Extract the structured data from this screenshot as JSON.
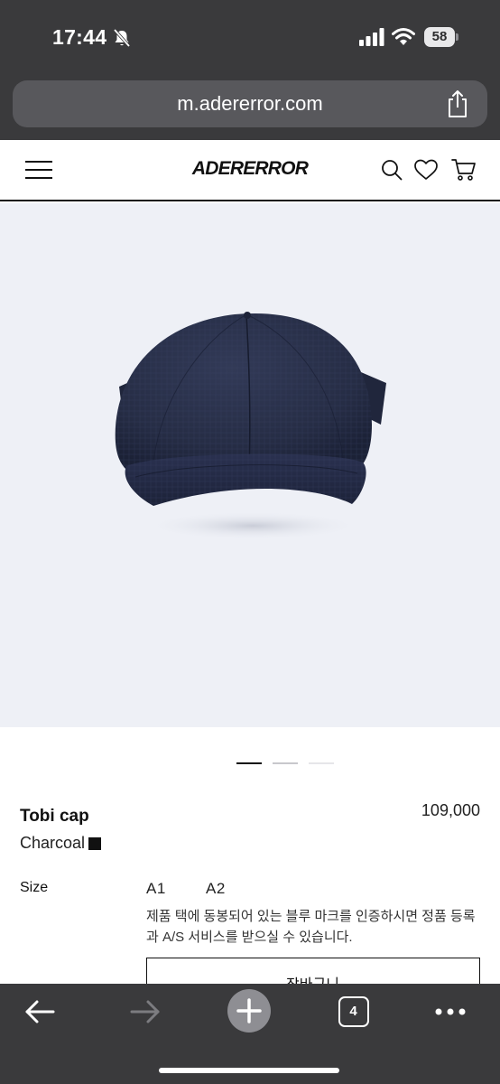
{
  "status_bar": {
    "time": "17:44",
    "battery": "58"
  },
  "browser": {
    "url": "m.adererror.com",
    "tabs_count": "4"
  },
  "site": {
    "logo": "ADERERROR"
  },
  "carousel": {
    "total": 3,
    "active_index": 0
  },
  "product": {
    "name": "Tobi cap",
    "price": "109,000",
    "color_name": "Charcoal",
    "size_label": "Size",
    "sizes": [
      "A1",
      "A2"
    ],
    "notice": "제품 택에 동봉되어 있는 블루 마크를 인증하시면 정품 등록과 A/S 서비스를 받으실 수 있습니다.",
    "cart_button": "장바구니"
  },
  "colors": {
    "chrome_dark": "#3a3a3c",
    "image_background": "#eef0f6",
    "cap_navy": "#262d45",
    "accent_black": "#111111"
  }
}
